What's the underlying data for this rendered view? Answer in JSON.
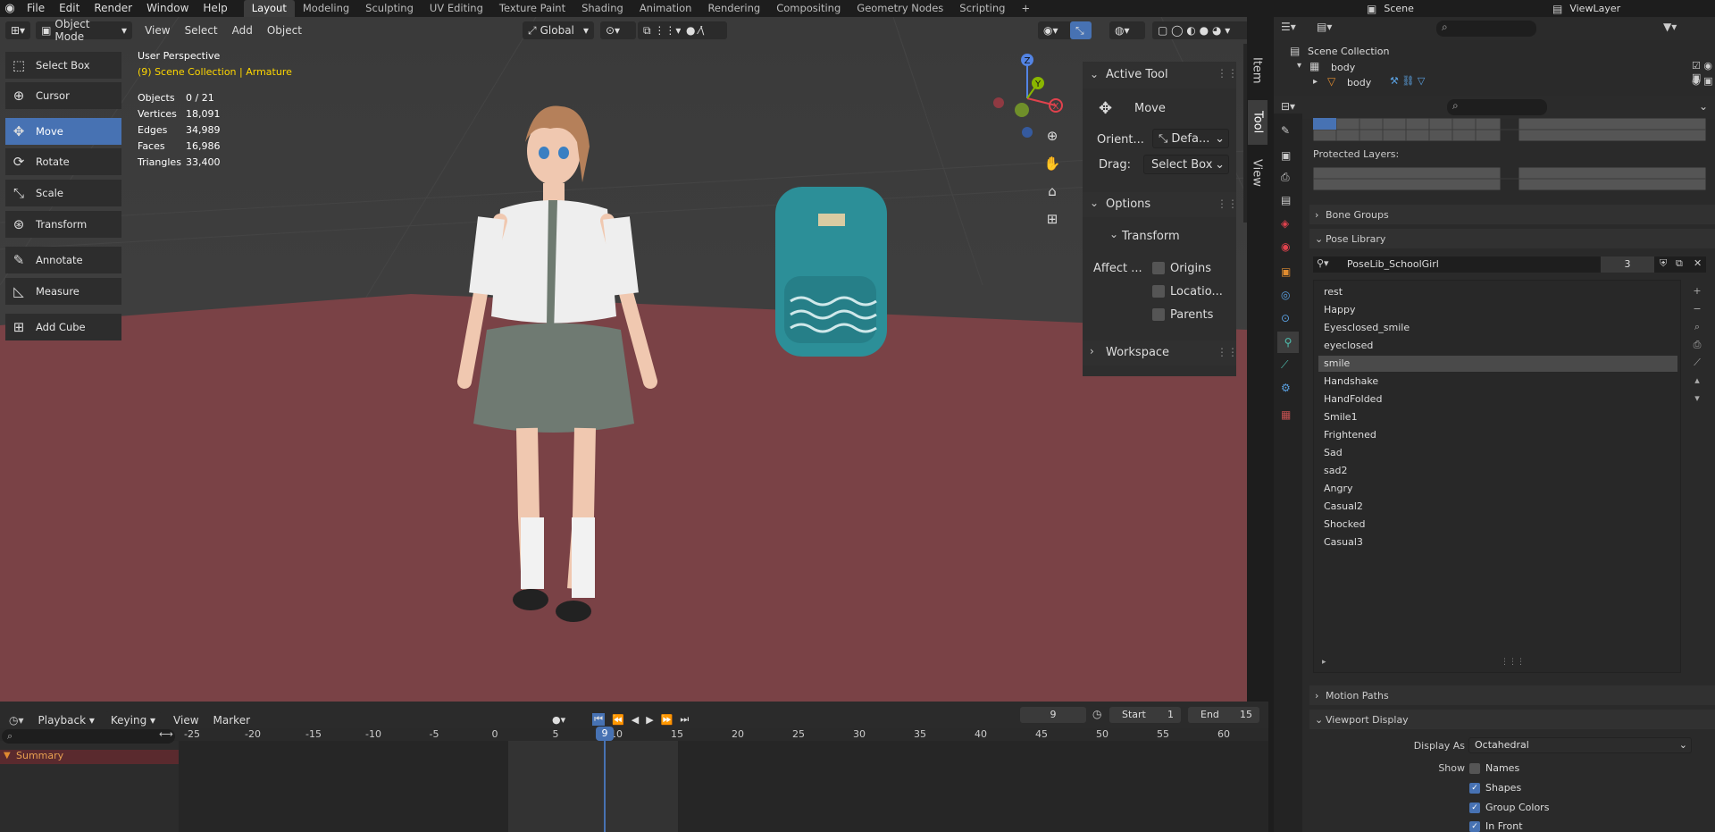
{
  "topbar": {
    "menu": [
      "File",
      "Edit",
      "Render",
      "Window",
      "Help"
    ],
    "workspaces": [
      "Layout",
      "Modeling",
      "Sculpting",
      "UV Editing",
      "Texture Paint",
      "Shading",
      "Animation",
      "Rendering",
      "Compositing",
      "Geometry Nodes",
      "Scripting"
    ],
    "active_workspace": "Layout",
    "scene": "Scene",
    "view_layer": "ViewLayer"
  },
  "viewport": {
    "mode": "Object Mode",
    "menus": [
      "View",
      "Select",
      "Add",
      "Object"
    ],
    "orientation": "Global",
    "overlay_title": "User Perspective",
    "overlay_sub": "(9) Scene Collection | Armature",
    "stats": [
      {
        "label": "Objects",
        "value": "0 / 21"
      },
      {
        "label": "Vertices",
        "value": "18,091"
      },
      {
        "label": "Edges",
        "value": "34,989"
      },
      {
        "label": "Faces",
        "value": "16,986"
      },
      {
        "label": "Triangles",
        "value": "33,400"
      }
    ],
    "tools": [
      "Select Box",
      "Cursor",
      "Move",
      "Rotate",
      "Scale",
      "Transform",
      "Annotate",
      "Measure",
      "Add Cube"
    ],
    "active_tool_index": 2,
    "gizmo": {
      "x": "X",
      "y": "Y",
      "z": "Z"
    }
  },
  "npanel": {
    "tabs": [
      "Item",
      "Tool",
      "View"
    ],
    "active_tool_header": "Active Tool",
    "tool_name": "Move",
    "orient_label": "Orient...",
    "orient_value": "Defa...",
    "drag_label": "Drag:",
    "drag_value": "Select Box",
    "options_header": "Options",
    "transform_header": "Transform",
    "affect_label": "Affect ...",
    "affect_options": [
      "Origins",
      "Locatio...",
      "Parents"
    ],
    "workspace_header": "Workspace"
  },
  "outliner": {
    "root": "Scene Collection",
    "items": [
      "body",
      "body"
    ]
  },
  "properties": {
    "protected_layers_label": "Protected Layers:",
    "bone_groups": "Bone Groups",
    "pose_library": "Pose Library",
    "pose_lib_name": "PoseLib_SchoolGirl",
    "pose_lib_users": "3",
    "poses": [
      "rest",
      "Happy",
      "Eyesclosed_smile",
      "eyeclosed",
      "smile",
      "Handshake",
      "HandFolded",
      "Smile1",
      "Frightened",
      "Sad",
      "sad2",
      "Angry",
      "Casual2",
      "Shocked",
      "Casual3"
    ],
    "selected_pose_index": 4,
    "motion_paths": "Motion Paths",
    "viewport_display": "Viewport Display",
    "display_as_label": "Display As",
    "display_as_value": "Octahedral",
    "show_label": "Show",
    "show_options": [
      {
        "label": "Names",
        "checked": false
      },
      {
        "label": "Shapes",
        "checked": true
      },
      {
        "label": "Group Colors",
        "checked": true
      },
      {
        "label": "In Front",
        "checked": true
      }
    ]
  },
  "timeline": {
    "menus": [
      "Playback",
      "Keying",
      "View",
      "Marker"
    ],
    "current_frame": "9",
    "start_label": "Start",
    "start_value": "1",
    "end_label": "End",
    "end_value": "15",
    "ticks": [
      "-25",
      "-20",
      "-15",
      "-10",
      "-5",
      "0",
      "5",
      "10",
      "15",
      "20",
      "25",
      "30",
      "35",
      "40",
      "45",
      "50",
      "55",
      "60"
    ],
    "playhead_label": "9",
    "channel": "Summary"
  },
  "colors": {
    "accent": "#4772b3",
    "floor": "#7a4246",
    "overlay_yellow": "#ffd700",
    "selection_orange": "#ff8c00"
  }
}
